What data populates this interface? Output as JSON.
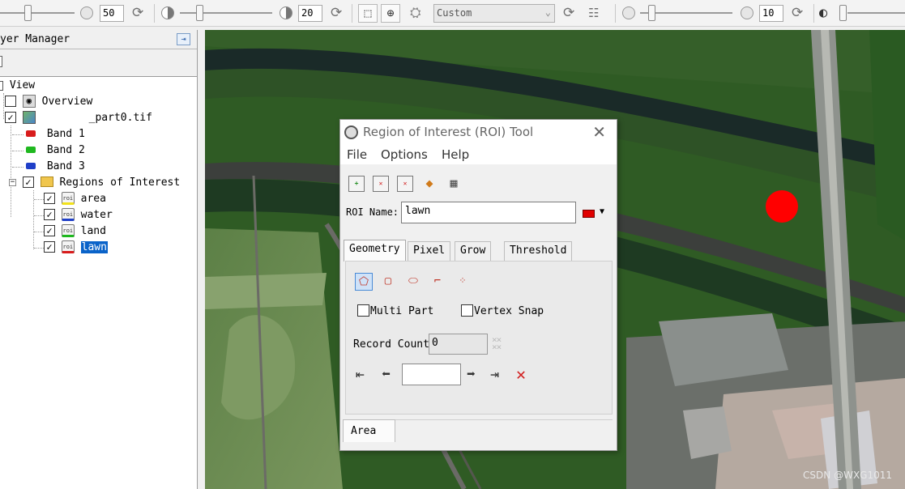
{
  "toolbar": {
    "brightness_value": "50",
    "contrast_value": "20",
    "stretch_mode": "Custom",
    "sharpen_value": "10"
  },
  "layer_manager": {
    "title": "yer Manager",
    "tree": {
      "root": "View",
      "overview": "Overview",
      "file": "_part0.tif",
      "bands": [
        "Band 1",
        "Band 2",
        "Band 3"
      ],
      "roi_folder": "Regions of Interest",
      "rois": [
        "area",
        "water",
        "land",
        "lawn"
      ]
    }
  },
  "roi_dialog": {
    "title": "Region of Interest (ROI) Tool",
    "menu": [
      "File",
      "Options",
      "Help"
    ],
    "roi_name_label": "ROI Name:",
    "roi_name_value": "lawn",
    "roi_color": "#e00000",
    "tabs": [
      "Geometry",
      "Pixel",
      "Grow",
      "Threshold"
    ],
    "multi_part_label": "Multi Part",
    "vertex_snap_label": "Vertex Snap",
    "record_count_label": "Record Count",
    "record_count_value": "0",
    "bottom_tab": "Area"
  },
  "watermark": "CSDN @WXG1011",
  "colors": {
    "selection": "#0a63c9",
    "band1": "#d81c1c",
    "band2": "#1fb81f",
    "band3": "#1f3fc8",
    "roi_blob": "#ff0000"
  }
}
